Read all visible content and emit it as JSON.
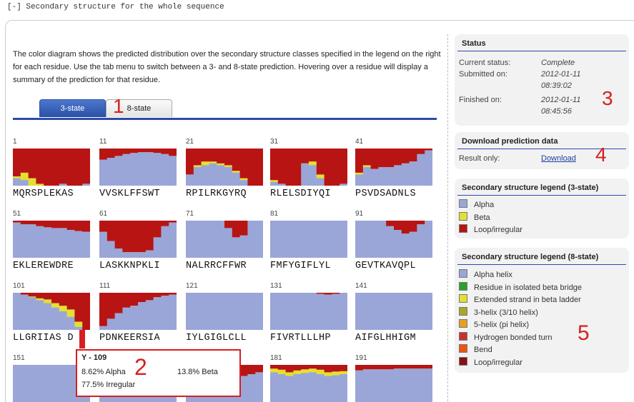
{
  "header": {
    "toggle": "[-]",
    "title": "Secondary structure for the whole sequence"
  },
  "description": "The color diagram shows the predicted distribution over the secondary structure classes specified in the legend on the right for each residue. Use the tab menu to switch between a 3- and 8-state prediction. Hovering over a residue will display a summary of the prediction for that residue.",
  "tabs": [
    {
      "label": "3-state",
      "active": true
    },
    {
      "label": "8-state",
      "active": false
    }
  ],
  "colors": {
    "alpha": "#9aa6d8",
    "beta": "#e4e032",
    "loop": "#b81414",
    "accent": "#2d4aa8",
    "annotation": "#d62020"
  },
  "segments": [
    {
      "pos": "1",
      "seq": "MQRSPLEKAS"
    },
    {
      "pos": "11",
      "seq": "VVSKLFFSWT"
    },
    {
      "pos": "21",
      "seq": "RPILRKGYRQ"
    },
    {
      "pos": "31",
      "seq": "RLELSDIYQI"
    },
    {
      "pos": "41",
      "seq": "PSVDSADNLS"
    },
    {
      "pos": "51",
      "seq": "EKLEREWDRE"
    },
    {
      "pos": "61",
      "seq": "LASKKNPKLI"
    },
    {
      "pos": "71",
      "seq": "NALRRCFFWR"
    },
    {
      "pos": "81",
      "seq": "FMFYGIFLYL"
    },
    {
      "pos": "91",
      "seq": "GEVTKAVQPL"
    },
    {
      "pos": "101",
      "seq": "LLGRIIAS D"
    },
    {
      "pos": "111",
      "seq": "PDNKEERSIA"
    },
    {
      "pos": "121",
      "seq": "IYLGIGLCLL"
    },
    {
      "pos": "131",
      "seq": "FIVRTLLLHP"
    },
    {
      "pos": "141",
      "seq": "AIFGLHHIGM"
    },
    {
      "pos": "151",
      "seq": ""
    },
    {
      "pos": "",
      "seq": ""
    },
    {
      "pos": "",
      "seq": ""
    },
    {
      "pos": "181",
      "seq": ""
    },
    {
      "pos": "191",
      "seq": ""
    }
  ],
  "tooltip": {
    "residue": "Y - 109",
    "alpha": "8.62% Alpha",
    "beta": "13.8% Beta",
    "irregular": "77.5% Irregular"
  },
  "status": {
    "title": "Status",
    "current_label": "Current status:",
    "current_value": "Complete",
    "submitted_label": "Submitted on:",
    "submitted_date": "2012-01-11",
    "submitted_time": "08:39:02",
    "finished_label": "Finished on:",
    "finished_date": "2012-01-11",
    "finished_time": "08:45:56"
  },
  "download": {
    "title": "Download prediction data",
    "label": "Result only:",
    "link": "Download"
  },
  "legend3": {
    "title": "Secondary structure legend (3-state)",
    "items": [
      {
        "label": "Alpha",
        "color": "#9aa6d8"
      },
      {
        "label": "Beta",
        "color": "#e4e032"
      },
      {
        "label": "Loop/irregular",
        "color": "#b81414"
      }
    ]
  },
  "legend8": {
    "title": "Secondary structure legend (8-state)",
    "items": [
      {
        "label": "Alpha helix",
        "color": "#9aa6d8"
      },
      {
        "label": "Residue in isolated beta bridge",
        "color": "#2ca02c"
      },
      {
        "label": "Extended strand in beta ladder",
        "color": "#e4e032"
      },
      {
        "label": "3-helix (3/10 helix)",
        "color": "#a8a82a"
      },
      {
        "label": "5-helix (pi helix)",
        "color": "#e8a020"
      },
      {
        "label": "Hydrogen bonded turn",
        "color": "#c83030"
      },
      {
        "label": "Bend",
        "color": "#ee5510"
      },
      {
        "label": "Loop/irregular",
        "color": "#8a1010"
      }
    ]
  },
  "annotations": [
    "1",
    "2",
    "3",
    "4",
    "5"
  ],
  "profiles": [
    {
      "alpha": [
        0.2,
        0.15,
        0.0,
        0.0,
        0.0,
        0.0,
        0.05,
        0.0,
        0.0,
        0.05
      ],
      "beta": [
        0.05,
        0.2,
        0.2,
        0.05,
        0.0,
        0.0,
        0.0,
        0.0,
        0.0,
        0.0
      ]
    },
    {
      "alpha": [
        0.7,
        0.75,
        0.8,
        0.85,
        0.88,
        0.9,
        0.9,
        0.88,
        0.85,
        0.8
      ],
      "beta": [
        0.0,
        0.0,
        0.0,
        0.0,
        0.0,
        0.0,
        0.0,
        0.0,
        0.0,
        0.0
      ]
    },
    {
      "alpha": [
        0.3,
        0.5,
        0.55,
        0.6,
        0.55,
        0.5,
        0.35,
        0.15,
        0.0,
        0.0
      ],
      "beta": [
        0.0,
        0.05,
        0.1,
        0.05,
        0.05,
        0.05,
        0.05,
        0.05,
        0.0,
        0.0
      ]
    },
    {
      "alpha": [
        0.1,
        0.05,
        0.0,
        0.0,
        0.6,
        0.55,
        0.2,
        0.0,
        0.0,
        0.05
      ],
      "beta": [
        0.05,
        0.0,
        0.0,
        0.0,
        0.0,
        0.1,
        0.1,
        0.0,
        0.0,
        0.0
      ]
    },
    {
      "alpha": [
        0.3,
        0.5,
        0.45,
        0.5,
        0.5,
        0.55,
        0.6,
        0.65,
        0.85,
        0.95
      ],
      "beta": [
        0.05,
        0.05,
        0.0,
        0.0,
        0.0,
        0.0,
        0.0,
        0.0,
        0.0,
        0.0
      ]
    },
    {
      "alpha": [
        0.95,
        0.9,
        0.9,
        0.85,
        0.82,
        0.8,
        0.8,
        0.75,
        0.72,
        0.7
      ],
      "beta": [
        0.0,
        0.0,
        0.0,
        0.0,
        0.0,
        0.0,
        0.0,
        0.0,
        0.0,
        0.0
      ]
    },
    {
      "alpha": [
        0.7,
        0.45,
        0.25,
        0.15,
        0.15,
        0.15,
        0.2,
        0.55,
        0.85,
        0.95
      ],
      "beta": [
        0.0,
        0.0,
        0.0,
        0.0,
        0.0,
        0.0,
        0.0,
        0.0,
        0.0,
        0.0
      ]
    },
    {
      "alpha": [
        1.0,
        1.0,
        1.0,
        1.0,
        1.0,
        0.8,
        0.55,
        0.6,
        1.0,
        1.0
      ],
      "beta": [
        0.0,
        0.0,
        0.0,
        0.0,
        0.0,
        0.0,
        0.0,
        0.0,
        0.0,
        0.0
      ]
    },
    {
      "alpha": [
        1.0,
        1.0,
        1.0,
        1.0,
        1.0,
        1.0,
        1.0,
        1.0,
        1.0,
        1.0
      ],
      "beta": [
        0.0,
        0.0,
        0.0,
        0.0,
        0.0,
        0.0,
        0.0,
        0.0,
        0.0,
        0.0
      ]
    },
    {
      "alpha": [
        1.0,
        1.0,
        1.0,
        1.0,
        0.85,
        0.75,
        0.65,
        0.7,
        0.9,
        1.0
      ],
      "beta": [
        0.0,
        0.0,
        0.0,
        0.0,
        0.0,
        0.0,
        0.0,
        0.0,
        0.0,
        0.0
      ]
    },
    {
      "alpha": [
        1.0,
        0.95,
        0.88,
        0.8,
        0.72,
        0.6,
        0.5,
        0.35,
        0.08,
        0.0
      ],
      "beta": [
        0.0,
        0.0,
        0.02,
        0.05,
        0.1,
        0.12,
        0.15,
        0.2,
        0.14,
        0.0
      ]
    },
    {
      "alpha": [
        0.1,
        0.3,
        0.45,
        0.6,
        0.65,
        0.75,
        0.8,
        0.88,
        0.92,
        0.95
      ],
      "beta": [
        0.0,
        0.0,
        0.0,
        0.0,
        0.0,
        0.0,
        0.0,
        0.0,
        0.0,
        0.0
      ]
    },
    {
      "alpha": [
        1.0,
        1.0,
        1.0,
        1.0,
        1.0,
        1.0,
        1.0,
        1.0,
        1.0,
        1.0
      ],
      "beta": [
        0.0,
        0.0,
        0.0,
        0.0,
        0.0,
        0.0,
        0.0,
        0.0,
        0.0,
        0.0
      ]
    },
    {
      "alpha": [
        1.0,
        1.0,
        1.0,
        1.0,
        1.0,
        1.0,
        0.97,
        0.95,
        0.97,
        1.0
      ],
      "beta": [
        0.0,
        0.0,
        0.0,
        0.0,
        0.0,
        0.0,
        0.0,
        0.0,
        0.0,
        0.0
      ]
    },
    {
      "alpha": [
        1.0,
        1.0,
        1.0,
        1.0,
        1.0,
        1.0,
        1.0,
        1.0,
        1.0,
        1.0
      ],
      "beta": [
        0.0,
        0.0,
        0.0,
        0.0,
        0.0,
        0.0,
        0.0,
        0.0,
        0.0,
        0.0
      ]
    },
    {
      "alpha": [
        1.0,
        1.0,
        1.0,
        1.0,
        1.0,
        1.0,
        1.0,
        1.0,
        1.0,
        1.0
      ],
      "beta": [
        0.0,
        0.0,
        0.0,
        0.0,
        0.0,
        0.0,
        0.0,
        0.0,
        0.0,
        0.0
      ]
    },
    {
      "alpha": [
        1.0,
        1.0,
        1.0,
        1.0,
        0.9,
        0.8,
        0.8,
        0.9,
        1.0,
        1.0
      ],
      "beta": [
        0.0,
        0.0,
        0.0,
        0.0,
        0.0,
        0.0,
        0.0,
        0.0,
        0.0,
        0.0
      ]
    },
    {
      "alpha": [
        0.8,
        0.75,
        0.7,
        0.7,
        0.7,
        0.7,
        0.7,
        0.7,
        0.75,
        0.8
      ],
      "beta": [
        0.0,
        0.0,
        0.0,
        0.0,
        0.0,
        0.0,
        0.0,
        0.0,
        0.0,
        0.0
      ]
    },
    {
      "alpha": [
        0.8,
        0.75,
        0.7,
        0.75,
        0.78,
        0.8,
        0.75,
        0.7,
        0.72,
        0.75
      ],
      "beta": [
        0.1,
        0.12,
        0.1,
        0.1,
        0.1,
        0.1,
        0.12,
        0.1,
        0.1,
        0.08
      ]
    },
    {
      "alpha": [
        0.85,
        0.88,
        0.88,
        0.88,
        0.88,
        0.9,
        0.9,
        0.9,
        0.9,
        0.9
      ],
      "beta": [
        0.0,
        0.0,
        0.0,
        0.0,
        0.0,
        0.0,
        0.0,
        0.0,
        0.0,
        0.0
      ]
    }
  ]
}
